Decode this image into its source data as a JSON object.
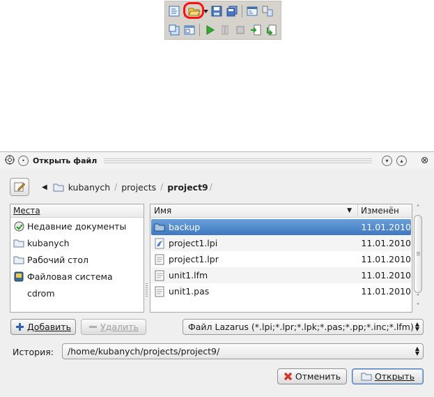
{
  "toolbar": {
    "row1_icons": [
      "new-form-icon",
      "open-file-icon",
      "save-icon",
      "save-all-icon",
      "toggle-form-icon",
      "view-units-icon"
    ],
    "row2_icons": [
      "new-unit-icon",
      "view-forms-icon",
      "run-icon",
      "pause-icon",
      "stop-icon",
      "step-into-icon",
      "step-over-icon"
    ],
    "highlight_color": "#ff1010"
  },
  "dialog": {
    "title": "Открыть файл",
    "breadcrumb": {
      "segments": [
        "kubanych",
        "projects",
        "project9"
      ]
    },
    "places": {
      "header": "Места",
      "items": [
        {
          "label": "Недавние документы",
          "icon": "recent-documents-icon"
        },
        {
          "label": "kubanych",
          "icon": "folder-icon"
        },
        {
          "label": "Рабочий стол",
          "icon": "folder-icon"
        },
        {
          "label": "Файловая система",
          "icon": "drive-icon"
        },
        {
          "label": "cdrom",
          "icon": ""
        }
      ]
    },
    "files": {
      "columns": {
        "name": "Имя",
        "modified": "Изменён"
      },
      "rows": [
        {
          "name": "backup",
          "date": "11.01.2010",
          "icon": "folder-icon",
          "selected": true
        },
        {
          "name": "project1.lpi",
          "date": "11.01.2010",
          "icon": "lazarus-project-icon",
          "selected": false
        },
        {
          "name": "project1.lpr",
          "date": "11.01.2010",
          "icon": "text-file-icon",
          "selected": false
        },
        {
          "name": "unit1.lfm",
          "date": "11.01.2010",
          "icon": "text-file-icon",
          "selected": false
        },
        {
          "name": "unit1.pas",
          "date": "11.01.2010",
          "icon": "text-file-icon",
          "selected": false
        }
      ]
    },
    "buttons": {
      "add": "Добавить",
      "remove": "Удалить",
      "cancel": "Отменить",
      "open": "Открыть"
    },
    "filter": {
      "selected": "Файл Lazarus (*.lpi;*.lpr;*.lpk;*.pas;*.pp;*.inc;*.lfm)"
    },
    "history": {
      "label": "История:",
      "value": "/home/kubanych/projects/project9/"
    },
    "colors": {
      "selection": "#3e78bf",
      "folder": "#a9c3df"
    }
  }
}
